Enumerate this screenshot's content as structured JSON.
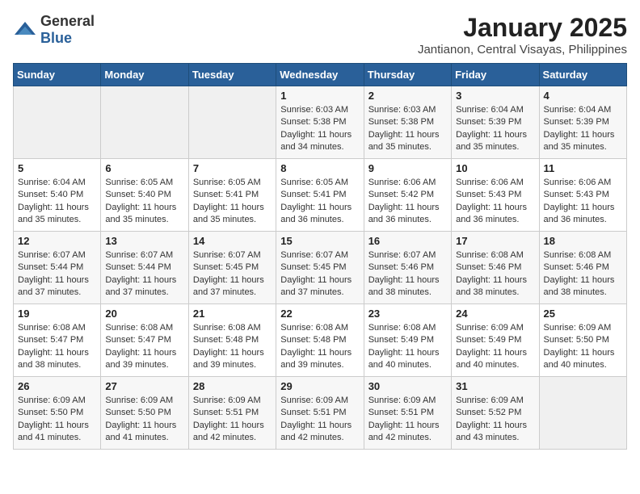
{
  "header": {
    "logo_general": "General",
    "logo_blue": "Blue",
    "month": "January 2025",
    "location": "Jantianon, Central Visayas, Philippines"
  },
  "days_of_week": [
    "Sunday",
    "Monday",
    "Tuesday",
    "Wednesday",
    "Thursday",
    "Friday",
    "Saturday"
  ],
  "weeks": [
    [
      {
        "day": "",
        "sunrise": "",
        "sunset": "",
        "daylight": ""
      },
      {
        "day": "",
        "sunrise": "",
        "sunset": "",
        "daylight": ""
      },
      {
        "day": "",
        "sunrise": "",
        "sunset": "",
        "daylight": ""
      },
      {
        "day": "1",
        "sunrise": "Sunrise: 6:03 AM",
        "sunset": "Sunset: 5:38 PM",
        "daylight": "Daylight: 11 hours and 34 minutes."
      },
      {
        "day": "2",
        "sunrise": "Sunrise: 6:03 AM",
        "sunset": "Sunset: 5:38 PM",
        "daylight": "Daylight: 11 hours and 35 minutes."
      },
      {
        "day": "3",
        "sunrise": "Sunrise: 6:04 AM",
        "sunset": "Sunset: 5:39 PM",
        "daylight": "Daylight: 11 hours and 35 minutes."
      },
      {
        "day": "4",
        "sunrise": "Sunrise: 6:04 AM",
        "sunset": "Sunset: 5:39 PM",
        "daylight": "Daylight: 11 hours and 35 minutes."
      }
    ],
    [
      {
        "day": "5",
        "sunrise": "Sunrise: 6:04 AM",
        "sunset": "Sunset: 5:40 PM",
        "daylight": "Daylight: 11 hours and 35 minutes."
      },
      {
        "day": "6",
        "sunrise": "Sunrise: 6:05 AM",
        "sunset": "Sunset: 5:40 PM",
        "daylight": "Daylight: 11 hours and 35 minutes."
      },
      {
        "day": "7",
        "sunrise": "Sunrise: 6:05 AM",
        "sunset": "Sunset: 5:41 PM",
        "daylight": "Daylight: 11 hours and 35 minutes."
      },
      {
        "day": "8",
        "sunrise": "Sunrise: 6:05 AM",
        "sunset": "Sunset: 5:41 PM",
        "daylight": "Daylight: 11 hours and 36 minutes."
      },
      {
        "day": "9",
        "sunrise": "Sunrise: 6:06 AM",
        "sunset": "Sunset: 5:42 PM",
        "daylight": "Daylight: 11 hours and 36 minutes."
      },
      {
        "day": "10",
        "sunrise": "Sunrise: 6:06 AM",
        "sunset": "Sunset: 5:43 PM",
        "daylight": "Daylight: 11 hours and 36 minutes."
      },
      {
        "day": "11",
        "sunrise": "Sunrise: 6:06 AM",
        "sunset": "Sunset: 5:43 PM",
        "daylight": "Daylight: 11 hours and 36 minutes."
      }
    ],
    [
      {
        "day": "12",
        "sunrise": "Sunrise: 6:07 AM",
        "sunset": "Sunset: 5:44 PM",
        "daylight": "Daylight: 11 hours and 37 minutes."
      },
      {
        "day": "13",
        "sunrise": "Sunrise: 6:07 AM",
        "sunset": "Sunset: 5:44 PM",
        "daylight": "Daylight: 11 hours and 37 minutes."
      },
      {
        "day": "14",
        "sunrise": "Sunrise: 6:07 AM",
        "sunset": "Sunset: 5:45 PM",
        "daylight": "Daylight: 11 hours and 37 minutes."
      },
      {
        "day": "15",
        "sunrise": "Sunrise: 6:07 AM",
        "sunset": "Sunset: 5:45 PM",
        "daylight": "Daylight: 11 hours and 37 minutes."
      },
      {
        "day": "16",
        "sunrise": "Sunrise: 6:07 AM",
        "sunset": "Sunset: 5:46 PM",
        "daylight": "Daylight: 11 hours and 38 minutes."
      },
      {
        "day": "17",
        "sunrise": "Sunrise: 6:08 AM",
        "sunset": "Sunset: 5:46 PM",
        "daylight": "Daylight: 11 hours and 38 minutes."
      },
      {
        "day": "18",
        "sunrise": "Sunrise: 6:08 AM",
        "sunset": "Sunset: 5:46 PM",
        "daylight": "Daylight: 11 hours and 38 minutes."
      }
    ],
    [
      {
        "day": "19",
        "sunrise": "Sunrise: 6:08 AM",
        "sunset": "Sunset: 5:47 PM",
        "daylight": "Daylight: 11 hours and 38 minutes."
      },
      {
        "day": "20",
        "sunrise": "Sunrise: 6:08 AM",
        "sunset": "Sunset: 5:47 PM",
        "daylight": "Daylight: 11 hours and 39 minutes."
      },
      {
        "day": "21",
        "sunrise": "Sunrise: 6:08 AM",
        "sunset": "Sunset: 5:48 PM",
        "daylight": "Daylight: 11 hours and 39 minutes."
      },
      {
        "day": "22",
        "sunrise": "Sunrise: 6:08 AM",
        "sunset": "Sunset: 5:48 PM",
        "daylight": "Daylight: 11 hours and 39 minutes."
      },
      {
        "day": "23",
        "sunrise": "Sunrise: 6:08 AM",
        "sunset": "Sunset: 5:49 PM",
        "daylight": "Daylight: 11 hours and 40 minutes."
      },
      {
        "day": "24",
        "sunrise": "Sunrise: 6:09 AM",
        "sunset": "Sunset: 5:49 PM",
        "daylight": "Daylight: 11 hours and 40 minutes."
      },
      {
        "day": "25",
        "sunrise": "Sunrise: 6:09 AM",
        "sunset": "Sunset: 5:50 PM",
        "daylight": "Daylight: 11 hours and 40 minutes."
      }
    ],
    [
      {
        "day": "26",
        "sunrise": "Sunrise: 6:09 AM",
        "sunset": "Sunset: 5:50 PM",
        "daylight": "Daylight: 11 hours and 41 minutes."
      },
      {
        "day": "27",
        "sunrise": "Sunrise: 6:09 AM",
        "sunset": "Sunset: 5:50 PM",
        "daylight": "Daylight: 11 hours and 41 minutes."
      },
      {
        "day": "28",
        "sunrise": "Sunrise: 6:09 AM",
        "sunset": "Sunset: 5:51 PM",
        "daylight": "Daylight: 11 hours and 42 minutes."
      },
      {
        "day": "29",
        "sunrise": "Sunrise: 6:09 AM",
        "sunset": "Sunset: 5:51 PM",
        "daylight": "Daylight: 11 hours and 42 minutes."
      },
      {
        "day": "30",
        "sunrise": "Sunrise: 6:09 AM",
        "sunset": "Sunset: 5:51 PM",
        "daylight": "Daylight: 11 hours and 42 minutes."
      },
      {
        "day": "31",
        "sunrise": "Sunrise: 6:09 AM",
        "sunset": "Sunset: 5:52 PM",
        "daylight": "Daylight: 11 hours and 43 minutes."
      },
      {
        "day": "",
        "sunrise": "",
        "sunset": "",
        "daylight": ""
      }
    ]
  ]
}
